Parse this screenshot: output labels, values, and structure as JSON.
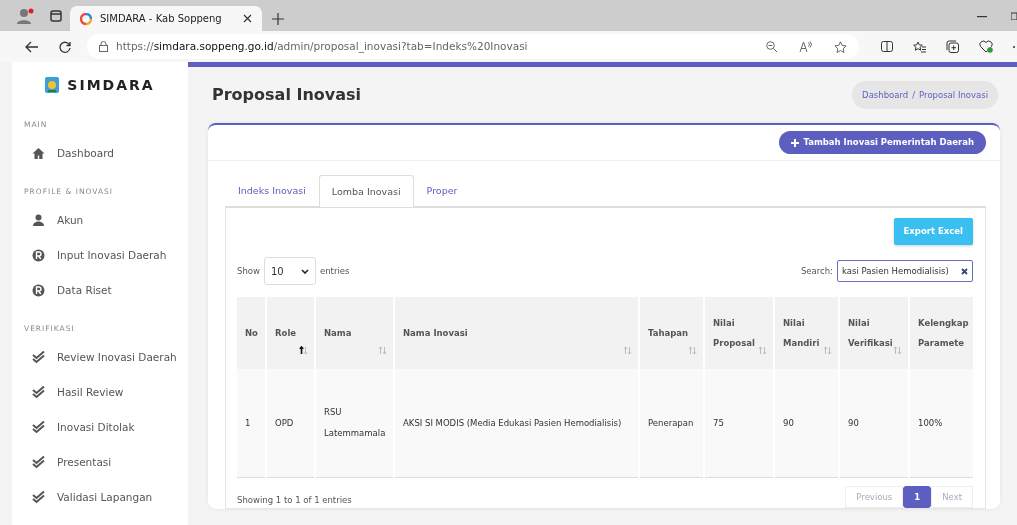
{
  "browser": {
    "tab_title": "SIMDARA - Kab Soppeng",
    "url": "https://**simdara.soppeng.go.id**/admin/proposal_inovasi?tab=Indeks%20Inovasi"
  },
  "sidebar": {
    "brand": "SIMDARA",
    "sections": [
      {
        "heading": "MAIN",
        "items": [
          {
            "label": "Dashboard",
            "kind": "home"
          }
        ]
      },
      {
        "heading": "PROFILE & INOVASI",
        "items": [
          {
            "label": "Akun",
            "kind": "user"
          },
          {
            "label": "Input Inovasi Daerah",
            "kind": "r"
          },
          {
            "label": "Data Riset",
            "kind": "r"
          }
        ]
      },
      {
        "heading": "VERIFIKASI",
        "items": [
          {
            "label": "Review Inovasi Daerah",
            "kind": "check"
          },
          {
            "label": "Hasil Review",
            "kind": "check"
          },
          {
            "label": "Inovasi Ditolak",
            "kind": "check"
          },
          {
            "label": "Presentasi",
            "kind": "check"
          },
          {
            "label": "Validasi Lapangan",
            "kind": "check"
          }
        ]
      }
    ]
  },
  "page": {
    "title": "Proposal Inovasi",
    "breadcrumb": [
      "Dashboard",
      "Proposal Inovasi"
    ],
    "breadcrumb_separator": "/"
  },
  "add_button": "Tambah Inovasi Pemerintah Daerah",
  "tabs": [
    {
      "label": "Indeks Inovasi",
      "selected": false
    },
    {
      "label": "Lomba Inovasi",
      "selected": true
    },
    {
      "label": "Proper",
      "selected": false
    }
  ],
  "export_button": "Export Excel",
  "length": {
    "show": "Show",
    "value": "10",
    "entries": "entries"
  },
  "search": {
    "label": "Search:",
    "value": "kasi Pasien Hemodialisis)"
  },
  "table": {
    "columns": [
      {
        "label": "No",
        "sortable": false
      },
      {
        "label": "Role",
        "sortable": true,
        "sorted_ascending": true
      },
      {
        "label": "Nama",
        "sortable": true,
        "sorted_ascending": false
      },
      {
        "label": "Nama Inovasi",
        "sortable": true,
        "sorted_ascending": false
      },
      {
        "label": "Tahapan",
        "sortable": true,
        "sorted_ascending": false
      },
      {
        "label": "Nilai Proposal",
        "sortable": true,
        "sorted_ascending": false
      },
      {
        "label": "Nilai Mandiri",
        "sortable": true,
        "sorted_ascending": false
      },
      {
        "label": "Nilai Verifikasi",
        "sortable": true,
        "sorted_ascending": false
      },
      {
        "label": "Kelengkap Paramete",
        "sortable": false
      }
    ],
    "rows": [
      [
        "1",
        "OPD",
        "RSU Latemmamala",
        "AKSI SI MODIS (Media Edukasi Pasien Hemodialisis)",
        "Penerapan",
        "75",
        "90",
        "90",
        "100%"
      ]
    ]
  },
  "info": "Showing 1 to 1 of 1 entries",
  "pagination": [
    {
      "label": "Previous",
      "disabled": true,
      "selected": false
    },
    {
      "label": "1",
      "disabled": false,
      "selected": true
    },
    {
      "label": "Next",
      "disabled": true,
      "selected": false
    }
  ]
}
